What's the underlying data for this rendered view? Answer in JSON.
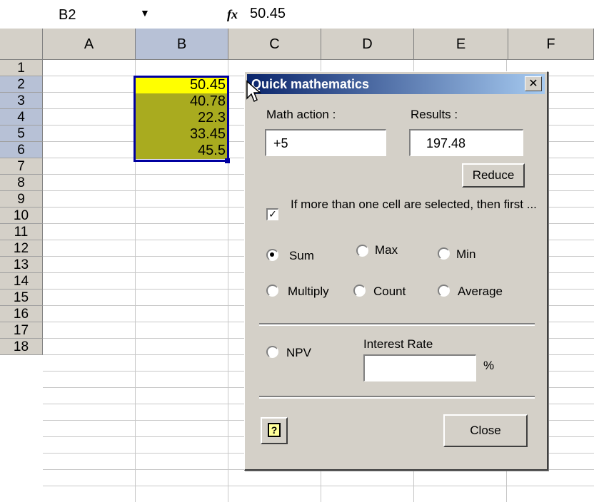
{
  "formula_bar": {
    "name_box": "B2",
    "fx_label": "fx",
    "value": "50.45"
  },
  "columns": [
    "A",
    "B",
    "C",
    "D",
    "E",
    "F"
  ],
  "rows": [
    "1",
    "2",
    "3",
    "4",
    "5",
    "6",
    "7",
    "8",
    "9",
    "10",
    "11",
    "12",
    "13",
    "14",
    "15",
    "16",
    "17",
    "18"
  ],
  "cells": {
    "B2": "50.45",
    "B3": "40.78",
    "B4": "22.3",
    "B5": "33.45",
    "B6": "45.5"
  },
  "colors": {
    "active_cell": "#ffff00",
    "selected_range": "#a9ab1f",
    "selection_border": "#0000a0",
    "titlebar_start": "#0a246a",
    "titlebar_end": "#a6caf0"
  },
  "dialog": {
    "title": "Quick mathematics",
    "close_glyph": "✕",
    "math_action_label": "Math action :",
    "math_action_value": "+5",
    "results_label": "Results :",
    "results_value": "197.48",
    "reduce_button": "Reduce",
    "checkbox_label": "If more than one cell are selected, then first ...",
    "checkbox_checked": true,
    "options": {
      "sum": "Sum",
      "max": "Max",
      "min": "Min",
      "multiply": "Multiply",
      "count": "Count",
      "average": "Average"
    },
    "selected_option": "Sum",
    "npv_label": "NPV",
    "interest_rate_label": "Interest Rate",
    "interest_rate_value": "",
    "percent_sign": "%",
    "help_icon": "help-icon",
    "help_glyph": "?",
    "close_button": "Close"
  }
}
